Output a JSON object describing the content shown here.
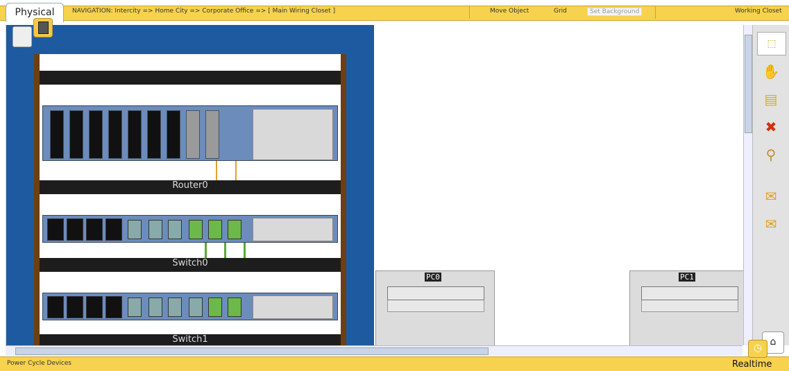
{
  "header": {
    "active_tab": "Physical",
    "navigation": "NAVIGATION:  Intercity =>  Home City =>  Corporate Office =>  [ Main Wiring Closet ]",
    "move_object": "Move Object",
    "grid": "Grid",
    "set_background": "Set Background",
    "working_closet": "Working Closet"
  },
  "devices": {
    "router": "Router0",
    "switch0": "Switch0",
    "switch1": "Switch1",
    "pc0": "PC0",
    "pc1": "PC1"
  },
  "toolbar": {
    "icons": [
      "select-icon",
      "hand-icon",
      "note-icon",
      "delete-icon",
      "zoom-icon",
      "add-simple-pdu-icon",
      "add-complex-pdu-icon"
    ]
  },
  "status": {
    "text": "Power Cycle Devices",
    "mode": "Realtime"
  }
}
